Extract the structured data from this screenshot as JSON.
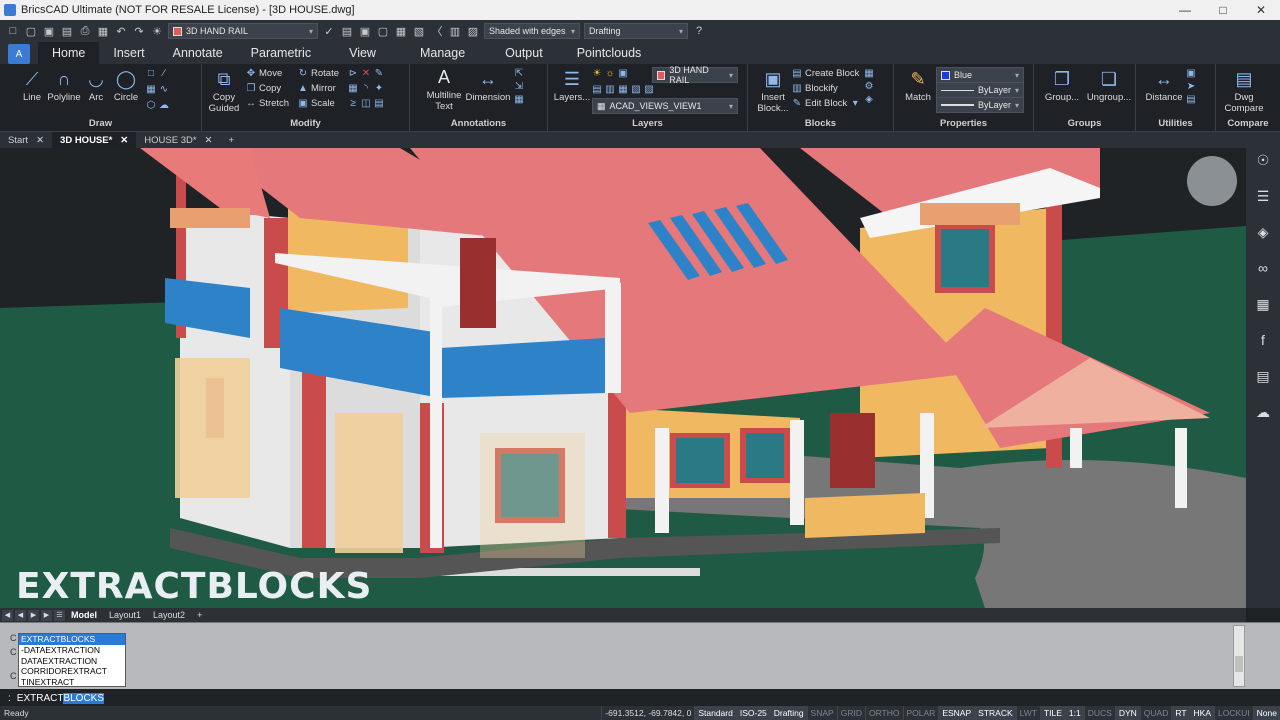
{
  "window": {
    "title": "BricsCAD Ultimate (NOT FOR RESALE License) - [3D HOUSE.dwg]"
  },
  "qat": {
    "layer": "3D HAND RAIL",
    "visual_style": "Shaded with edges",
    "workspace": "Drafting"
  },
  "ribbon_tabs": [
    "Home",
    "Insert",
    "Annotate",
    "Parametric",
    "View",
    "Manage",
    "Output",
    "Pointclouds"
  ],
  "ribbon": {
    "draw": {
      "title": "Draw",
      "line": "Line",
      "polyline": "Polyline",
      "arc": "Arc",
      "circle": "Circle"
    },
    "modify": {
      "title": "Modify",
      "copy_guided_1": "Copy",
      "copy_guided_2": "Guided",
      "move": "Move",
      "copy": "Copy",
      "stretch": "Stretch",
      "rotate": "Rotate",
      "mirror": "Mirror",
      "scale": "Scale"
    },
    "annotations": {
      "title": "Annotations",
      "mtext_1": "Multiline",
      "mtext_2": "Text",
      "dimension": "Dimension"
    },
    "layers": {
      "title": "Layers",
      "layers_btn": "Layers...",
      "current_layer": "3D HAND RAIL",
      "view": "ACAD_VIEWS_VIEW1"
    },
    "blocks": {
      "title": "Blocks",
      "insert_1": "Insert",
      "insert_2": "Block...",
      "create": "Create Block",
      "blockify": "Blockify",
      "edit": "Edit Block"
    },
    "properties": {
      "title": "Properties",
      "match": "Match",
      "color": "Blue",
      "linetype": "ByLayer",
      "lineweight": "ByLayer"
    },
    "groups": {
      "title": "Groups",
      "group": "Group...",
      "ungroup": "Ungroup..."
    },
    "utilities": {
      "title": "Utilities",
      "distance": "Distance"
    },
    "compare": {
      "title": "Compare",
      "dwg_1": "Dwg",
      "dwg_2": "Compare"
    }
  },
  "doc_tabs": [
    "Start",
    "3D HOUSE*",
    "HOUSE 3D*"
  ],
  "overlay_caption": "EXTRACTBLOCKS",
  "layout_tabs": [
    "Model",
    "Layout1",
    "Layout2"
  ],
  "autocomplete": [
    "EXTRACTBLOCKS",
    "-DATAEXTRACTION",
    "DATAEXTRACTION",
    "CORRIDOREXTRACT",
    "TINEXTRACT"
  ],
  "command": {
    "prompt": ":",
    "typed": "EXTRACT",
    "completion": "BLOCKS"
  },
  "status": {
    "ready": "Ready",
    "coords": "-691.3512, -69.7842, 0",
    "items_on": [
      "Standard",
      "ISO-25",
      "Drafting"
    ],
    "toggles": [
      {
        "label": "SNAP",
        "on": false
      },
      {
        "label": "GRID",
        "on": false
      },
      {
        "label": "ORTHO",
        "on": false
      },
      {
        "label": "POLAR",
        "on": false
      },
      {
        "label": "ESNAP",
        "on": true
      },
      {
        "label": "STRACK",
        "on": true
      },
      {
        "label": "LWT",
        "on": false
      },
      {
        "label": "TILE",
        "on": true
      },
      {
        "label": "1:1",
        "on": true
      },
      {
        "label": "DUCS",
        "on": false
      },
      {
        "label": "DYN",
        "on": true
      },
      {
        "label": "QUAD",
        "on": false
      },
      {
        "label": "RT",
        "on": true
      },
      {
        "label": "HKA",
        "on": true
      },
      {
        "label": "LOCKUI",
        "on": false
      },
      {
        "label": "None",
        "on": true
      }
    ]
  },
  "colors": {
    "roof": "#e5787a",
    "wall": "#e8e8e8",
    "brick": "#c94b4b",
    "glass": "#2d82c8",
    "wood": "#f0b860",
    "ground": "#1f5a44"
  }
}
